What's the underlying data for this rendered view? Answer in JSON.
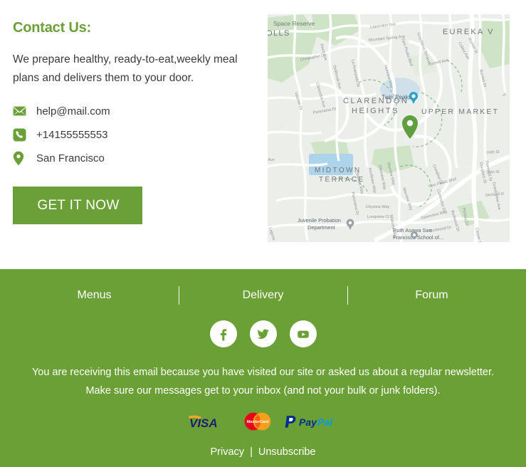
{
  "contact": {
    "heading": "Contact Us:",
    "description": "We prepare healthy, ready-to-eat,weekly meal plans and delivers them to your door.",
    "items": [
      {
        "icon": "envelope-icon",
        "text": "help@mail.com"
      },
      {
        "icon": "phone-icon",
        "text": "+14155555553"
      },
      {
        "icon": "location-pin-icon",
        "text": "San Francisco"
      }
    ],
    "cta_label": "GET IT NOW"
  },
  "map": {
    "marker": "green-location-pin",
    "poi_label": "Twin Peaks",
    "labels": [
      "Space Reserve",
      "OLLS",
      "Clarendon Ave",
      "Mountain Spring Ave",
      "Twin Peaks Blvd",
      "Graystone Terrace",
      "EUREKA V",
      "Market St",
      "Copper Ave",
      "Christopher Dr",
      "Reed Ave",
      "Dellbrook Ave",
      "La Avanzada St",
      "Marview Way",
      "Burnett Ave",
      "Clarendon Ave",
      "CLARENDON HEIGHTS",
      "UPPER MARKET",
      "Panorama Dr",
      "Stanton Way",
      "Knollview Way",
      "Glenview Way",
      "Skyview Way",
      "MIDTOWN TERRACE",
      "Cityview Way",
      "Longview Ct",
      "Midcrest Way",
      "Crestline Dr",
      "Twin Peaks Blvd",
      "Clarendon Dr",
      "Dawnview Way",
      "Burlwood Dr",
      "Portola Dr",
      "Clipper St",
      "Juvenile Probation Department",
      "Ruth Asawa San Francisco School of...",
      "24th St",
      "25th St",
      "Diamond St",
      "Douglass St",
      "Grand View Ave",
      "Laguna"
    ]
  },
  "footer": {
    "nav": [
      {
        "label": "Menus"
      },
      {
        "label": "Delivery"
      },
      {
        "label": "Forum"
      }
    ],
    "social": [
      {
        "name": "facebook-icon",
        "label": "Facebook"
      },
      {
        "name": "twitter-icon",
        "label": "Twitter"
      },
      {
        "name": "youtube-icon",
        "label": "YouTube"
      }
    ],
    "disclaimer": "You are receiving this email because you have visited our site or asked us about a regular newsletter. Make sure our messages get to your inbox (and not your bulk or junk folders).",
    "payments": [
      {
        "name": "visa-logo",
        "label": "VISA"
      },
      {
        "name": "mastercard-logo",
        "label": "MasterCard"
      },
      {
        "name": "paypal-logo",
        "label": "PayPal"
      }
    ],
    "privacy_label": "Privacy",
    "separator": "|",
    "unsubscribe_label": "Unsubscribe"
  },
  "colors": {
    "brand_green": "#6aa036",
    "footer_green": "#6aa036",
    "text_dark": "#3b3b3b",
    "white": "#ffffff"
  }
}
